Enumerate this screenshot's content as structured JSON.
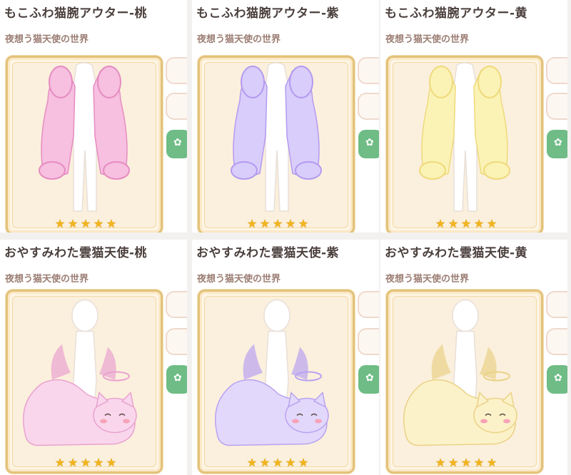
{
  "items": [
    {
      "title": "もこふわ猫腕アウター-桃",
      "subtitle": "夜想う猫天使の世界",
      "stars": 5,
      "color_main": "#f7bfe0",
      "color_dark": "#e58cc2",
      "type": "coat"
    },
    {
      "title": "もこふわ猫腕アウター-紫",
      "subtitle": "夜想う猫天使の世界",
      "stars": 5,
      "color_main": "#d9cdfb",
      "color_dark": "#b49af0",
      "type": "coat"
    },
    {
      "title": "もこふわ猫腕アウター-黄",
      "subtitle": "夜想う猫天使の世界",
      "stars": 5,
      "color_main": "#fbf3b5",
      "color_dark": "#efd97c",
      "type": "coat"
    },
    {
      "title": "おやすみわた雲猫天使-桃",
      "subtitle": "夜想う猫天使の世界",
      "stars": 5,
      "color_main": "#f9d6ec",
      "color_dark": "#e9a2cf",
      "type": "cat"
    },
    {
      "title": "おやすみわた雲猫天使-紫",
      "subtitle": "夜想う猫天使の世界",
      "stars": 5,
      "color_main": "#e2d8fb",
      "color_dark": "#b9a2f1",
      "type": "cat"
    },
    {
      "title": "おやすみわた雲猫天使-黄",
      "subtitle": "夜想う猫天使の世界",
      "stars": 5,
      "color_main": "#fcf2c9",
      "color_dark": "#ead287",
      "type": "cat"
    }
  ],
  "star_glyph": "★",
  "button_icon": "paw-icon"
}
